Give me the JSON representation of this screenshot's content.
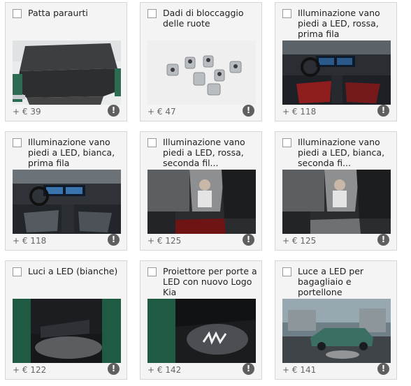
{
  "accessories": [
    {
      "title": "Patta paraurti",
      "price": "+ € 39",
      "image": "bumper-protector-image"
    },
    {
      "title": "Dadi di bloccaggio delle ruote",
      "price": "+ € 47",
      "image": "wheel-lock-nuts-image"
    },
    {
      "title": "Illuminazione vano piedi a LED, rossa, prima fila",
      "price": "+ € 118",
      "image": "red-footwell-front-image"
    },
    {
      "title": "Illuminazione vano piedi a LED, bianca, prima fila",
      "price": "+ € 118",
      "image": "white-footwell-front-image"
    },
    {
      "title": "Illuminazione vano piedi a LED, rossa, seconda fil...",
      "price": "+ € 125",
      "image": "red-footwell-rear-image"
    },
    {
      "title": "Illuminazione vano piedi a LED, bianca, seconda fi...",
      "price": "+ € 125",
      "image": "white-footwell-rear-image"
    },
    {
      "title": "Luci a LED (bianche)",
      "price": "+ € 122",
      "image": "door-led-lights-image"
    },
    {
      "title": "Proiettore per porte a LED con nuovo Logo Kia",
      "price": "+ € 142",
      "image": "logo-projector-image"
    },
    {
      "title": "Luce a LED per bagagliaio e portellone",
      "price": "+ € 141",
      "image": "tailgate-led-image"
    }
  ],
  "info_icon_glyph": "!"
}
